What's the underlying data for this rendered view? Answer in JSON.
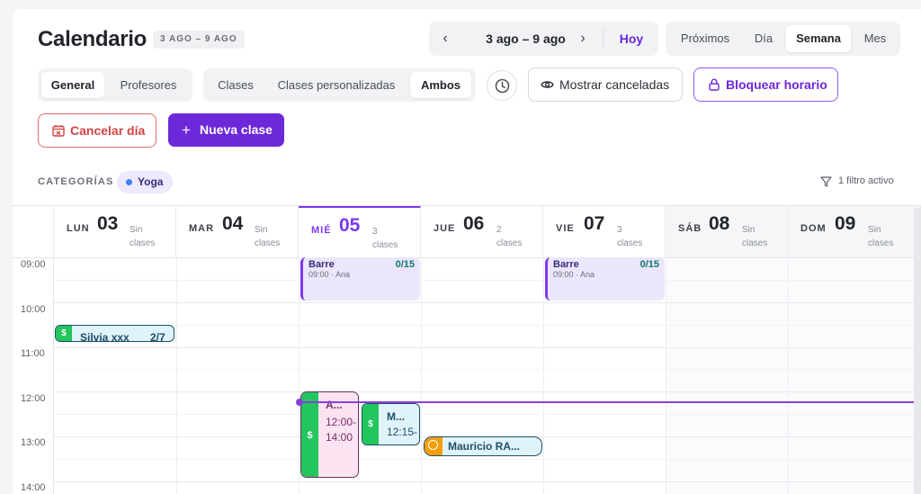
{
  "header": {
    "title": "Calendario",
    "range_badge": "3 AGO – 9 AGO",
    "nav_range": "3 ago – 9 ago",
    "today_label": "Hoy",
    "views": [
      "Próximos",
      "Día",
      "Semana",
      "Mes"
    ],
    "active_view": "Semana"
  },
  "toolbar": {
    "scope": [
      "General",
      "Profesores"
    ],
    "active_scope": "General",
    "class_types": [
      "Clases",
      "Clases personalizadas",
      "Ambos"
    ],
    "active_class_type": "Ambos",
    "show_cancelled": "Mostrar canceladas",
    "block_schedule": "Bloquear horario",
    "cancel_day": "Cancelar día",
    "new_class": "Nueva clase"
  },
  "filters": {
    "categories_label": "CATEGORÍAS",
    "category_chip": "Yoga",
    "active_filters": "1 filtro activo"
  },
  "days": [
    {
      "name": "LUN",
      "num": "03",
      "sub": "Sin clases"
    },
    {
      "name": "MAR",
      "num": "04",
      "sub": "Sin clases"
    },
    {
      "name": "MIÉ",
      "num": "05",
      "sub": "3 clases"
    },
    {
      "name": "JUE",
      "num": "06",
      "sub": "2 clases"
    },
    {
      "name": "VIE",
      "num": "07",
      "sub": "3 clases"
    },
    {
      "name": "SÁB",
      "num": "08",
      "sub": "Sin clases"
    },
    {
      "name": "DOM",
      "num": "09",
      "sub": "Sin clases"
    }
  ],
  "times": [
    "09:00",
    "10:00",
    "11:00",
    "12:00",
    "13:00",
    "14:00"
  ],
  "events": {
    "barre_wed": {
      "title": "Barre",
      "count": "0/15",
      "sub": "09:00 · Ana"
    },
    "barre_fri": {
      "title": "Barre",
      "count": "0/15",
      "sub": "09:00 · Ana"
    },
    "silvia": {
      "title": "Silvia xxx",
      "count": "2/7",
      "icon": "$"
    },
    "pink": {
      "title": "A...",
      "start": "12:00-",
      "end": "14:00",
      "icon": "$"
    },
    "blue_small": {
      "title": "M...",
      "time": "12:15-",
      "icon": "$"
    },
    "mauricio": {
      "title": "Mauricio RA..."
    }
  },
  "colors": {
    "accent": "#6d28d9",
    "danger": "#d14343",
    "paid_stripe": "#22c55e",
    "pending_stripe": "#f59e0b",
    "now_line": "#8b3fd9"
  }
}
